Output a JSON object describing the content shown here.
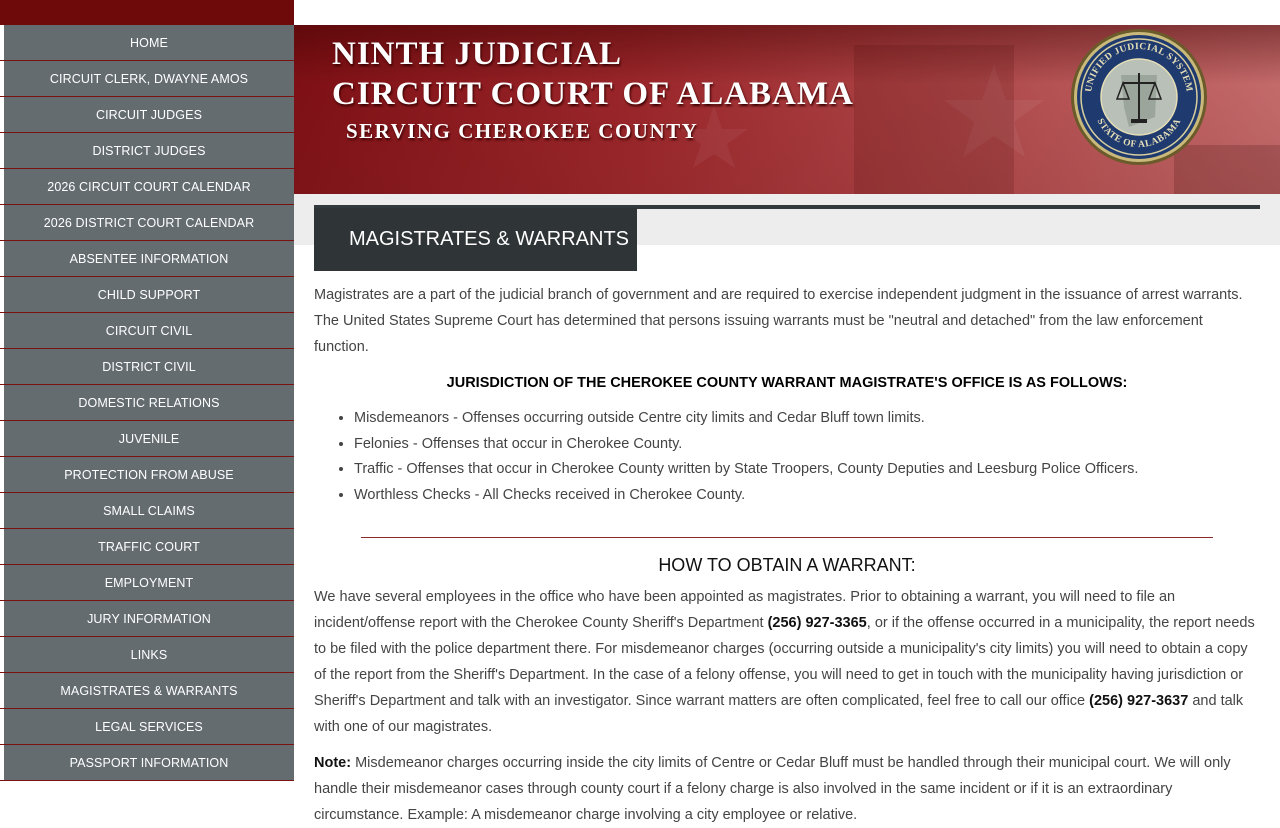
{
  "sidebar": {
    "items": [
      {
        "label": "HOME"
      },
      {
        "label": "CIRCUIT CLERK, DWAYNE AMOS"
      },
      {
        "label": "CIRCUIT JUDGES"
      },
      {
        "label": "DISTRICT JUDGES"
      },
      {
        "label": "2026 CIRCUIT COURT CALENDAR"
      },
      {
        "label": "2026 DISTRICT COURT CALENDAR"
      },
      {
        "label": "ABSENTEE INFORMATION"
      },
      {
        "label": "CHILD SUPPORT"
      },
      {
        "label": "CIRCUIT CIVIL"
      },
      {
        "label": "DISTRICT CIVIL"
      },
      {
        "label": "DOMESTIC RELATIONS"
      },
      {
        "label": "JUVENILE"
      },
      {
        "label": "PROTECTION FROM ABUSE"
      },
      {
        "label": "SMALL CLAIMS"
      },
      {
        "label": "TRAFFIC COURT"
      },
      {
        "label": "EMPLOYMENT"
      },
      {
        "label": "JURY INFORMATION"
      },
      {
        "label": "LINKS"
      },
      {
        "label": "MAGISTRATES & WARRANTS"
      },
      {
        "label": "LEGAL SERVICES"
      },
      {
        "label": "PASSPORT INFORMATION"
      }
    ]
  },
  "header": {
    "line1": "NINTH JUDICIAL",
    "line2": "CIRCUIT COURT OF ALABAMA",
    "line3": "SERVING CHEROKEE COUNTY",
    "seal": {
      "top_text": "UNIFIED JUDICIAL SYSTEM",
      "bottom_text": "STATE OF ALABAMA"
    }
  },
  "page": {
    "title": "MAGISTRATES & WARRANTS",
    "intro": "Magistrates are a part of the judicial branch of government and are required to exercise independent judgment in the issuance of arrest warrants. The United States Supreme Court has determined that persons issuing warrants must be \"neutral and detached\" from the law enforcement function.",
    "jurisdiction_heading": "JURISDICTION OF THE CHEROKEE COUNTY WARRANT MAGISTRATE'S OFFICE IS AS FOLLOWS:",
    "jurisdiction_items": [
      "Misdemeanors - Offenses occurring outside Centre city limits and Cedar Bluff town limits.",
      "Felonies - Offenses that occur in Cherokee County.",
      "Traffic - Offenses that occur in Cherokee County written by State Troopers, County Deputies and Leesburg Police Officers.",
      "Worthless Checks - All Checks received in Cherokee County."
    ],
    "howto_heading": "HOW TO OBTAIN A WARRANT:",
    "howto_part1": "We have several employees in the office who have been appointed as magistrates. Prior to obtaining a warrant, you will need to file an incident/offense report with the Cherokee County Sheriff's Department ",
    "sheriff_phone": "(256) 927-3365",
    "howto_part2": ", or if the offense occurred in a municipality, the report needs to be filed with the police department there. For misdemeanor charges (occurring outside a municipality's city limits) you will need to obtain a copy of the report from the Sheriff's Department. In the case of a felony offense, you will need to get in touch with the municipality having jurisdiction or Sheriff's Department and talk with an investigator. Since warrant matters are often complicated, feel free to call our office ",
    "office_phone": "(256) 927-3637",
    "howto_part3": " and talk with one of our magistrates.",
    "note_label": "Note:",
    "note_text": " Misdemeanor charges occurring inside the city limits of Centre or Cedar Bluff must be handled through their municipal court. We will only handle their misdemeanor cases through county court if a felony charge is also involved in the same incident or if it is an extraordinary circumstance. Example: A misdemeanor charge involving a city employee or relative."
  },
  "colors": {
    "sidebar_bg": "#646c70",
    "sidebar_top": "#6e0a0a",
    "banner": "#9a262a",
    "title_box": "#2f3437"
  }
}
